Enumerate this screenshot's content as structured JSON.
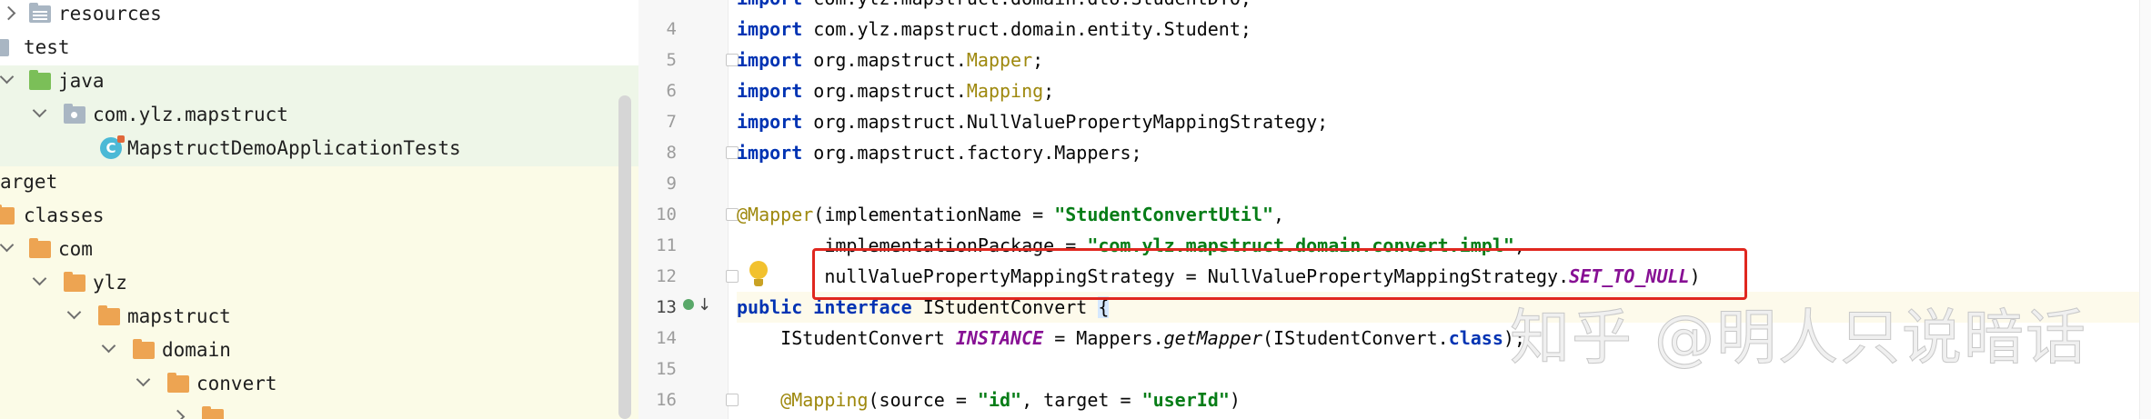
{
  "project_tree": {
    "items": [
      {
        "label": "resources",
        "icon": "resources-folder-icon"
      },
      {
        "label": "test",
        "icon": "folder-icon"
      },
      {
        "label": "java",
        "icon": "test-sources-folder-icon"
      },
      {
        "label": "com.ylz.mapstruct",
        "icon": "package-icon"
      },
      {
        "label": "MapstructDemoApplicationTests",
        "icon": "test-class-icon"
      },
      {
        "label": "arget",
        "icon": "folder-icon"
      },
      {
        "label": "classes",
        "icon": "folder-icon"
      },
      {
        "label": "com",
        "icon": "folder-icon"
      },
      {
        "label": "ylz",
        "icon": "folder-icon"
      },
      {
        "label": "mapstruct",
        "icon": "folder-icon"
      },
      {
        "label": "domain",
        "icon": "folder-icon"
      },
      {
        "label": "convert",
        "icon": "folder-icon"
      }
    ]
  },
  "editor": {
    "line_numbers": [
      "4",
      "5",
      "6",
      "7",
      "8",
      "9",
      "10",
      "11",
      "12",
      "13",
      "14",
      "15",
      "16"
    ],
    "lines": {
      "l3": [
        "import",
        " com.ylz.mapstruct.domain.dto.StudentDTO;"
      ],
      "l4": [
        "import",
        " com.ylz.mapstruct.domain.entity.Student;"
      ],
      "l5": [
        "import",
        " org.mapstruct.",
        "Mapper",
        ";"
      ],
      "l6": [
        "import",
        " org.mapstruct.",
        "Mapping",
        ";"
      ],
      "l7": [
        "import",
        " org.mapstruct.NullValuePropertyMappingStrategy;"
      ],
      "l8": [
        "import",
        " org.mapstruct.factory.Mappers;"
      ],
      "l10": [
        "@Mapper",
        "(implementationName = ",
        "\"StudentConvertUtil\"",
        ","
      ],
      "l11": [
        "        implementationPackage = ",
        "\"com.ylz.mapstruct.domain.convert.impl\"",
        ","
      ],
      "l12": [
        "        nullValuePropertyMappingStrategy = NullValuePropertyMappingStrategy.",
        "SET_TO_NULL",
        ")"
      ],
      "l13": [
        "public",
        " ",
        "interface",
        " IStudentConvert ",
        "{"
      ],
      "l14": [
        "    IStudentConvert ",
        "INSTANCE",
        " = Mappers.",
        "getMapper",
        "(IStudentConvert.",
        "class",
        ");"
      ],
      "l16": [
        "    ",
        "@Mapping",
        "(source = ",
        "\"id\"",
        ", target = ",
        "\"userId\"",
        ")"
      ]
    }
  },
  "watermark": "知乎 @明人只说暗话",
  "colors": {
    "keyword": "#0033b3",
    "annotation": "#9e880d",
    "string": "#067d17",
    "constant": "#871094",
    "highlight_box": "#e0271f"
  }
}
